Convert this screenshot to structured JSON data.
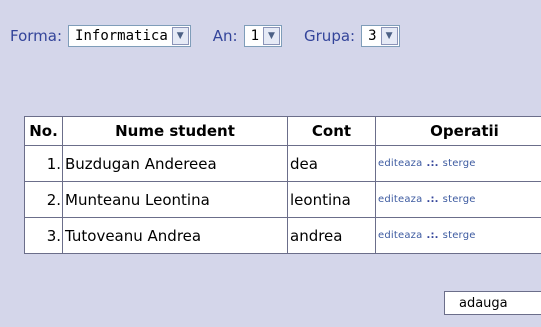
{
  "filters": {
    "forma": {
      "label": "Forma:",
      "value": "Informatica"
    },
    "an": {
      "label": "An:",
      "value": "1"
    },
    "grupa": {
      "label": "Grupa:",
      "value": "3"
    }
  },
  "table": {
    "headers": [
      "No.",
      "Nume student",
      "Cont",
      "Operatii"
    ],
    "rows": [
      {
        "no": "1.",
        "name": "Buzdugan Andereea",
        "cont": "dea",
        "edit": "editeaza",
        "sep": ".:.",
        "delete": "sterge"
      },
      {
        "no": "2.",
        "name": "Munteanu Leontina",
        "cont": "leontina",
        "edit": "editeaza",
        "sep": ".:.",
        "delete": "sterge"
      },
      {
        "no": "3.",
        "name": "Tutoveanu Andrea",
        "cont": "andrea",
        "edit": "editeaza",
        "sep": ".:.",
        "delete": "sterge"
      }
    ]
  },
  "add_button": "adauga",
  "icons": {
    "dropdown": "chevron-down-icon"
  }
}
